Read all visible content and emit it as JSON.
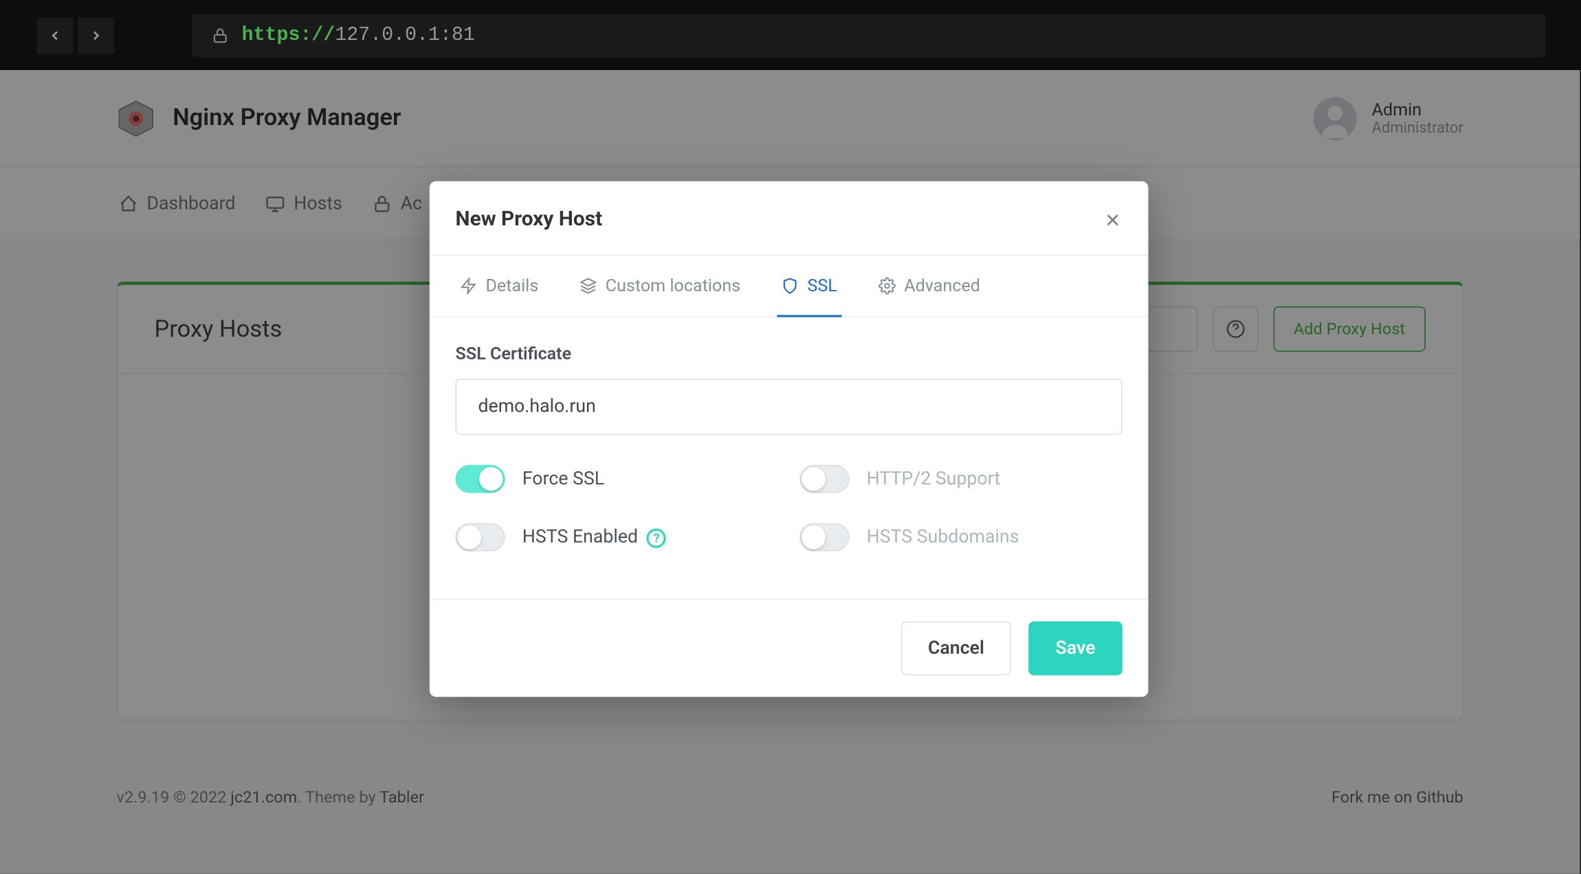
{
  "browser": {
    "url_scheme": "https://",
    "url_rest": "127.0.0.1:81"
  },
  "header": {
    "title": "Nginx Proxy Manager",
    "user": {
      "name": "Admin",
      "role": "Administrator"
    }
  },
  "nav": {
    "dashboard": "Dashboard",
    "hosts": "Hosts",
    "access": "Ac"
  },
  "page": {
    "title": "Proxy Hosts",
    "add_btn": "Add Proxy Host"
  },
  "modal": {
    "title": "New Proxy Host",
    "tabs": {
      "details": "Details",
      "custom": "Custom locations",
      "ssl": "SSL",
      "advanced": "Advanced"
    },
    "ssl": {
      "cert_label": "SSL Certificate",
      "cert_value": "demo.halo.run",
      "force_ssl": "Force SSL",
      "http2": "HTTP/2 Support",
      "hsts": "HSTS Enabled",
      "hsts_sub": "HSTS Subdomains"
    },
    "footer": {
      "cancel": "Cancel",
      "save": "Save"
    }
  },
  "footer": {
    "version": "v2.9.19 © 2022 ",
    "link1": "jc21.com",
    "mid": ". Theme by ",
    "link2": "Tabler",
    "fork": "Fork me on Github"
  }
}
